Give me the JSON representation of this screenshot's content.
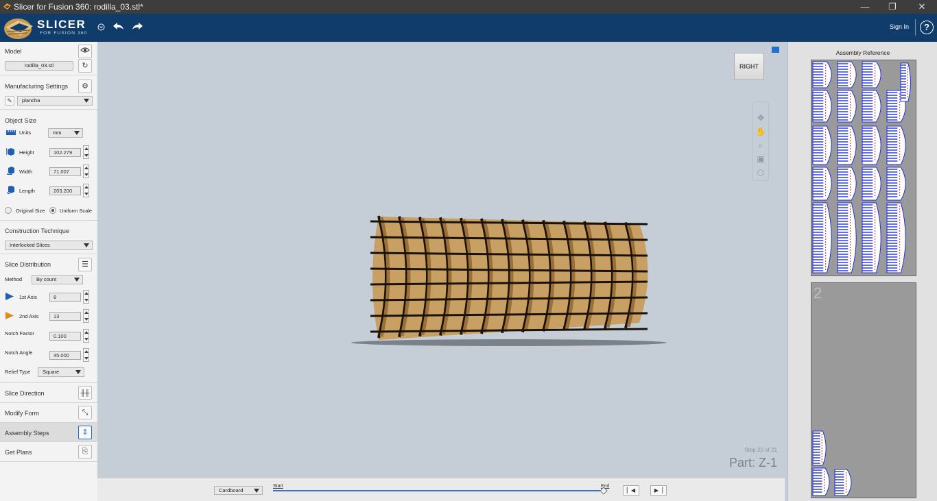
{
  "window": {
    "title": "Slicer for Fusion 360: rodilla_03.stl*",
    "controls": {
      "minimize": "—",
      "restore": "❐",
      "close": "✕"
    }
  },
  "appbar": {
    "brand": "SLICER",
    "brand_sub": "FOR FUSION 360",
    "brand_menu_icon": "circle-chevron-icon",
    "undo_icon": "undo-icon",
    "redo_icon": "redo-icon",
    "sign_in": "Sign In",
    "help": "?"
  },
  "left_panel": {
    "model": {
      "title": "Model",
      "file": "rodilla_03.stl",
      "icons": [
        "eye-icon",
        "refresh-icon"
      ]
    },
    "manufacturing": {
      "title": "Manufacturing Settings",
      "profile": "plancha",
      "icons": [
        "gear-icon",
        "pencil-icon"
      ]
    },
    "object_size": {
      "title": "Object Size",
      "units_label": "Units",
      "units_value": "mm",
      "height_label": "Height",
      "height_value": "102.279",
      "width_label": "Width",
      "width_value": "71.007",
      "length_label": "Length",
      "length_value": "203.200",
      "original_size": "Original Size",
      "uniform_scale": "Uniform Scale",
      "uniform_selected": true
    },
    "construction": {
      "title": "Construction Technique",
      "value": "Interlocked Slices"
    },
    "slice_distribution": {
      "title": "Slice Distribution",
      "method_label": "Method",
      "method_value": "By count",
      "axis1_label": "1st Axis",
      "axis1_value": "8",
      "axis2_label": "2nd Axis",
      "axis2_value": "13",
      "notch_factor_label": "Notch Factor",
      "notch_factor_value": "0.100",
      "notch_angle_label": "Notch Angle",
      "notch_angle_value": "45.000",
      "relief_label": "Relief Type",
      "relief_value": "Square",
      "axis1_color": "#1e5fb4",
      "axis2_color": "#e08a1e"
    },
    "slice_direction": {
      "title": "Slice Direction"
    },
    "modify_form": {
      "title": "Modify Form"
    },
    "assembly_steps": {
      "title": "Assembly Steps",
      "active": true
    },
    "get_plans": {
      "title": "Get Plans"
    }
  },
  "viewport": {
    "view_cube": "RIGHT",
    "nav_icons": [
      "orbit-icon",
      "pan-icon",
      "zoom-icon",
      "fit-icon",
      "view-cube-icon"
    ],
    "step": "Step 20 of 21",
    "part": "Part: Z-1",
    "model_colors": {
      "light": "#c8a064",
      "dark": "#9a7038",
      "outline": "#1a1209"
    }
  },
  "bottom_bar": {
    "material": "Cardboard",
    "start": "Start",
    "end": "End",
    "progress": 1.0,
    "prev": "◀",
    "next": "▶"
  },
  "right_panel": {
    "title": "Assembly Reference",
    "sheet2_number": "2",
    "accent_blue": "#1f2fd8",
    "accent_red": "#e02020"
  }
}
